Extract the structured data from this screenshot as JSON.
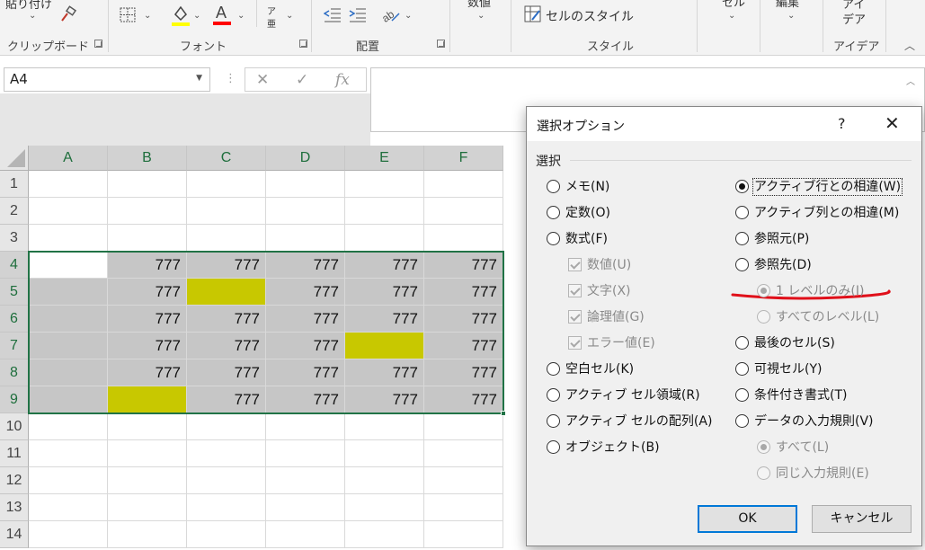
{
  "ribbon": {
    "clipboard": {
      "paste_label": "貼り付け",
      "label": "クリップボード"
    },
    "font": {
      "label": "フォント",
      "furigana_top": "ア",
      "furigana_bottom": "亜"
    },
    "alignment": {
      "label": "配置"
    },
    "number": {
      "label": "数値"
    },
    "styles": {
      "cell_styles": "セルのスタイル",
      "label": "スタイル"
    },
    "cells": {
      "label": "セル"
    },
    "editing": {
      "label": "編集"
    },
    "ideas": {
      "top": "アイ",
      "bottom": "デア",
      "label": "アイデア"
    },
    "colors": {
      "highlight": "#ffff00",
      "font_color": "#ff0000"
    }
  },
  "formula_bar": {
    "name_box": "A4",
    "fx": "fx",
    "value": ""
  },
  "sheet": {
    "columns": [
      "A",
      "B",
      "C",
      "D",
      "E",
      "F"
    ],
    "rows": [
      "1",
      "2",
      "3",
      "4",
      "5",
      "6",
      "7",
      "8",
      "9",
      "10",
      "11",
      "12",
      "13",
      "14"
    ],
    "selected_rows": [
      "4",
      "5",
      "6",
      "7",
      "8",
      "9"
    ],
    "selection": "A4:F9",
    "active_cell": "A4",
    "data": [
      [
        "",
        "",
        "",
        "",
        "",
        ""
      ],
      [
        "",
        "",
        "",
        "",
        "",
        ""
      ],
      [
        "",
        "",
        "",
        "",
        "",
        ""
      ],
      [
        "",
        "777",
        "777",
        "777",
        "777",
        "777"
      ],
      [
        "",
        "777",
        "",
        "777",
        "777",
        "777"
      ],
      [
        "",
        "777",
        "777",
        "777",
        "777",
        "777"
      ],
      [
        "",
        "777",
        "777",
        "777",
        "",
        "777"
      ],
      [
        "",
        "777",
        "777",
        "777",
        "777",
        "777"
      ],
      [
        "",
        "",
        "777",
        "777",
        "777",
        "777"
      ],
      [
        "",
        "",
        "",
        "",
        "",
        ""
      ],
      [
        "",
        "",
        "",
        "",
        "",
        ""
      ],
      [
        "",
        "",
        "",
        "",
        "",
        ""
      ],
      [
        "",
        "",
        "",
        "",
        "",
        ""
      ],
      [
        "",
        "",
        "",
        "",
        "",
        ""
      ]
    ],
    "highlighted_cells": [
      "C5",
      "E7",
      "B9"
    ],
    "colors": {
      "selection_fill": "#c6c6c6",
      "highlight_fill": "#c8c800",
      "selection_border": "#217346"
    }
  },
  "dialog": {
    "title": "選択オプション",
    "help": "?",
    "close": "✕",
    "group_label": "選択",
    "left_options": [
      {
        "label": "メモ(N)",
        "kind": "radio",
        "checked": false,
        "disabled": false
      },
      {
        "label": "定数(O)",
        "kind": "radio",
        "checked": false,
        "disabled": false
      },
      {
        "label": "数式(F)",
        "kind": "radio",
        "checked": false,
        "disabled": false
      },
      {
        "label": "数値(U)",
        "kind": "checkbox",
        "checked": true,
        "disabled": true
      },
      {
        "label": "文字(X)",
        "kind": "checkbox",
        "checked": true,
        "disabled": true
      },
      {
        "label": "論理値(G)",
        "kind": "checkbox",
        "checked": true,
        "disabled": true
      },
      {
        "label": "エラー値(E)",
        "kind": "checkbox",
        "checked": true,
        "disabled": true
      },
      {
        "label": "空白セル(K)",
        "kind": "radio",
        "checked": false,
        "disabled": false
      },
      {
        "label": "アクティブ セル領域(R)",
        "kind": "radio",
        "checked": false,
        "disabled": false
      },
      {
        "label": "アクティブ セルの配列(A)",
        "kind": "radio",
        "checked": false,
        "disabled": false
      },
      {
        "label": "オブジェクト(B)",
        "kind": "radio",
        "checked": false,
        "disabled": false
      }
    ],
    "right_options": [
      {
        "label": "アクティブ行との相違(W)",
        "kind": "radio",
        "checked": true,
        "disabled": false,
        "focused": true
      },
      {
        "label": "アクティブ列との相違(M)",
        "kind": "radio",
        "checked": false,
        "disabled": false
      },
      {
        "label": "参照元(P)",
        "kind": "radio",
        "checked": false,
        "disabled": false
      },
      {
        "label": "参照先(D)",
        "kind": "radio",
        "checked": false,
        "disabled": false
      },
      {
        "label": "1 レベルのみ(I)",
        "kind": "radio",
        "checked": true,
        "disabled": true
      },
      {
        "label": "すべてのレベル(L)",
        "kind": "radio",
        "checked": false,
        "disabled": true
      },
      {
        "label": "最後のセル(S)",
        "kind": "radio",
        "checked": false,
        "disabled": false
      },
      {
        "label": "可視セル(Y)",
        "kind": "radio",
        "checked": false,
        "disabled": false
      },
      {
        "label": "条件付き書式(T)",
        "kind": "radio",
        "checked": false,
        "disabled": false
      },
      {
        "label": "データの入力規則(V)",
        "kind": "radio",
        "checked": false,
        "disabled": false
      },
      {
        "label": "すべて(L)",
        "kind": "radio",
        "checked": true,
        "disabled": true
      },
      {
        "label": "同じ入力規則(E)",
        "kind": "radio",
        "checked": false,
        "disabled": true
      }
    ],
    "ok_label": "OK",
    "cancel_label": "キャンセル",
    "annotation_color": "#e0101a"
  }
}
